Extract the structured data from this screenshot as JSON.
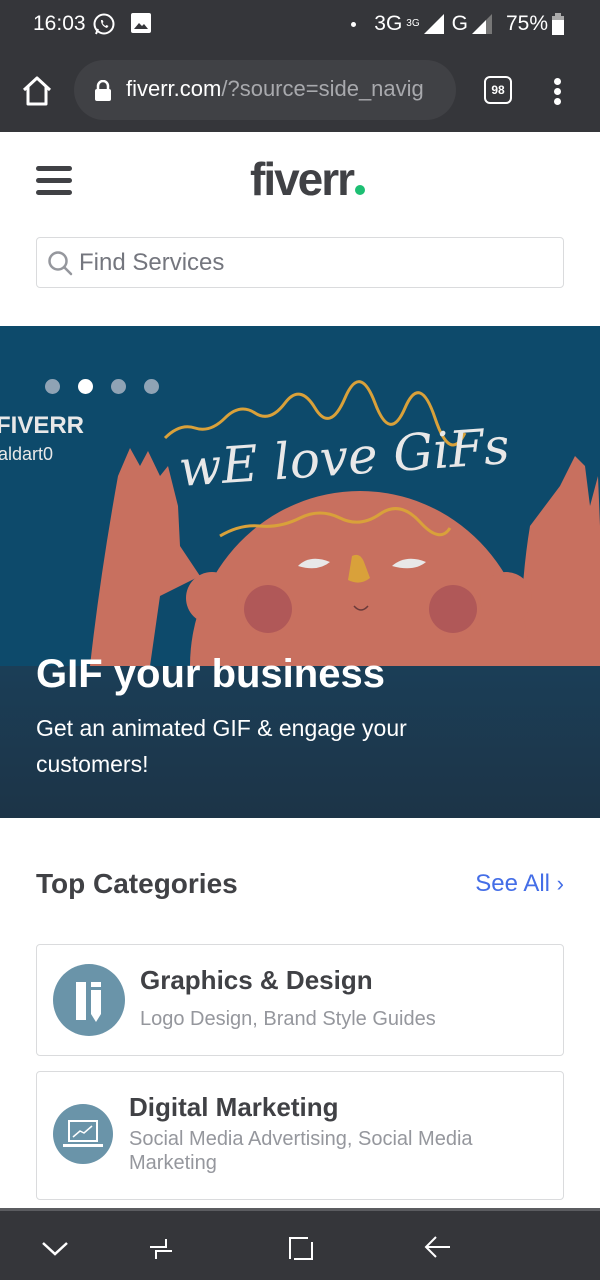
{
  "status_bar": {
    "time": "16:03",
    "network_1": "3G",
    "network_1_sup": "3G",
    "network_2": "G",
    "battery": "75%",
    "icons": [
      "whatsapp-icon",
      "gallery-icon",
      "dot-icon",
      "signal-icon",
      "signal-icon",
      "battery-icon"
    ]
  },
  "browser": {
    "url_host": "fiverr.com",
    "url_path": "/?source=side_navig",
    "tab_count": "98"
  },
  "header": {
    "logo_text": "fiverr",
    "logo_dot_color": "#1dbf73",
    "search_placeholder": "Find Services"
  },
  "banner": {
    "carousel_dots": 4,
    "active_dot_index": 1,
    "credit_line_1": "FIVERR",
    "credit_line_2": "aldart0",
    "art_text": "wE love GiFs",
    "title": "GIF your business",
    "subtitle": "Get an animated GIF & engage your customers!"
  },
  "top_categories": {
    "title": "Top Categories",
    "see_all": "See All",
    "see_all_color": "#446ee7",
    "items": [
      {
        "title": "Graphics & Design",
        "subtitle": "Logo Design, Brand Style Guides",
        "icon": "pencil-ruler-icon"
      },
      {
        "title": "Digital Marketing",
        "subtitle": "Social Media Advertising, Social Media Marketing",
        "icon": "laptop-chart-icon"
      }
    ]
  },
  "nav_bar": {
    "buttons": [
      "collapse-icon",
      "recents-icon",
      "home-square-icon",
      "back-icon"
    ]
  }
}
